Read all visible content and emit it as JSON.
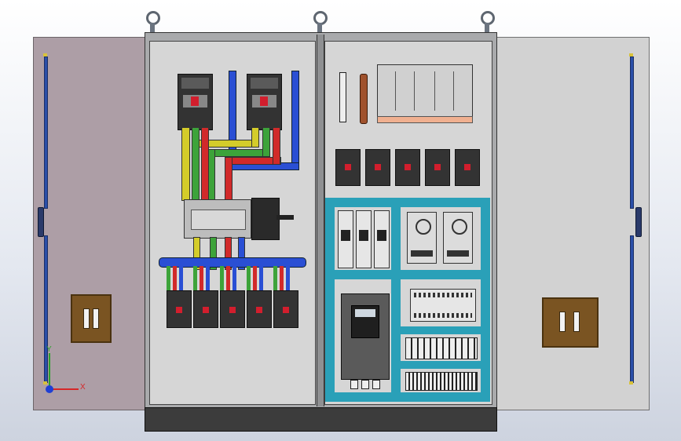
{
  "axis_triad": {
    "y_label": "Y",
    "x_label": "X"
  },
  "colors": {
    "phase_yellow": "#d4cc2a",
    "phase_green": "#3da33a",
    "phase_red": "#d12a2a",
    "neutral_blue": "#2a4fd4",
    "din_rail": "#2aa0b8",
    "left_door": "#ad9ea6",
    "right_door": "#d2d2d2"
  },
  "icons": [
    "lifting-eye-icon",
    "axis-triad-icon",
    "door-lock-icon"
  ]
}
